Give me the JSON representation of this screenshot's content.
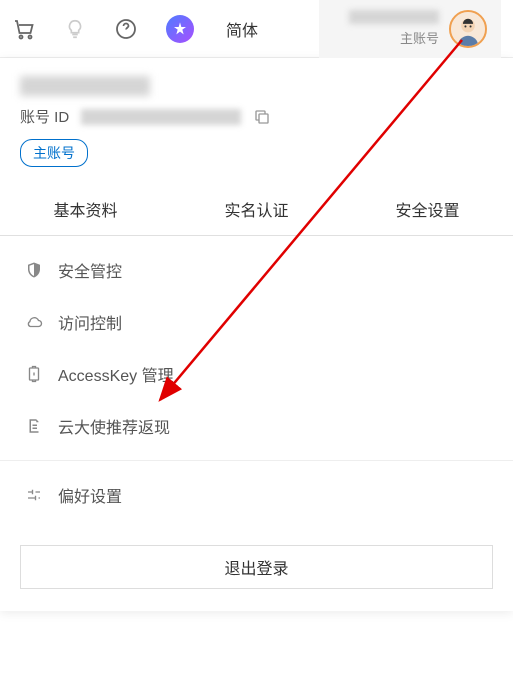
{
  "topbar": {
    "lang_label": "简体",
    "account_type": "主账号"
  },
  "account": {
    "id_label": "账号 ID",
    "badge_label": "主账号"
  },
  "tabs": [
    {
      "label": "基本资料"
    },
    {
      "label": "实名认证"
    },
    {
      "label": "安全设置"
    }
  ],
  "menu": {
    "security_control": "安全管控",
    "access_control": "访问控制",
    "accesskey_mgmt": "AccessKey 管理",
    "ambassador": "云大使推荐返现",
    "preferences": "偏好设置"
  },
  "logout_label": "退出登录"
}
